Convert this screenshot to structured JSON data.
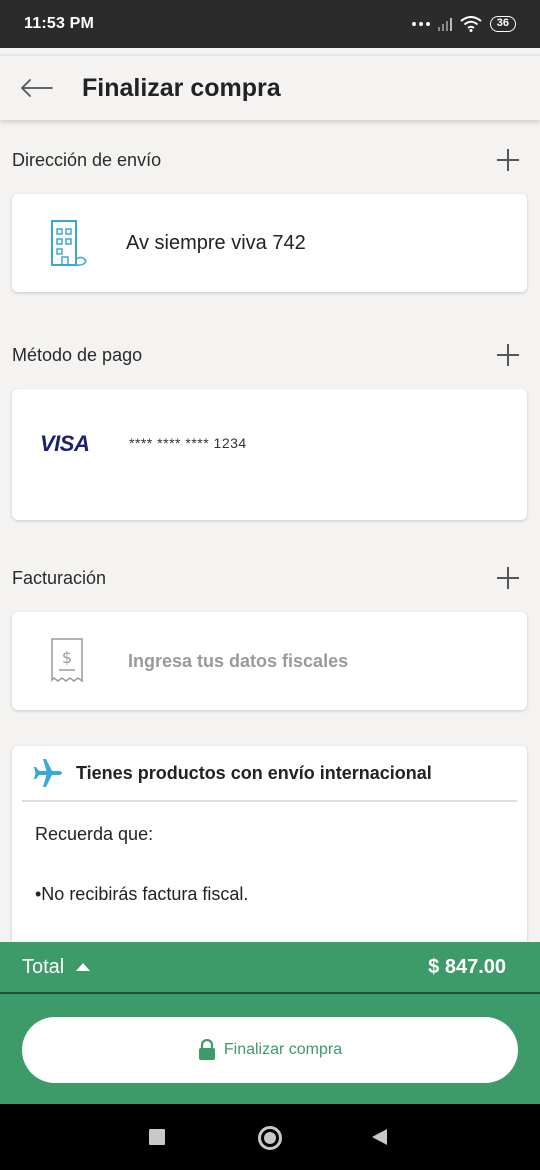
{
  "status_bar": {
    "time": "11:53 PM",
    "battery": "36"
  },
  "app_bar": {
    "title": "Finalizar compra"
  },
  "shipping": {
    "label": "Dirección de envío",
    "address": "Av siempre viva 742"
  },
  "payment": {
    "label": "Método de pago",
    "brand": "VISA",
    "card_number": "**** **** **** 1234"
  },
  "billing": {
    "label": "Facturación",
    "placeholder": "Ingresa tus datos fiscales"
  },
  "international": {
    "title": "Tienes productos con envío internacional",
    "line1": "Recuerda que:",
    "line2": "•No recibirás factura fiscal."
  },
  "total": {
    "label": "Total",
    "amount": "$ 847.00"
  },
  "action": {
    "label": "Finalizar compra"
  },
  "colors": {
    "brand_green": "#3c9b69",
    "visa_blue": "#1a1f71",
    "icon_blue": "#3aa8d8"
  },
  "icons": [
    "back-arrow-icon",
    "plus-icon",
    "building-icon",
    "receipt-icon",
    "airplane-icon",
    "lock-icon"
  ]
}
